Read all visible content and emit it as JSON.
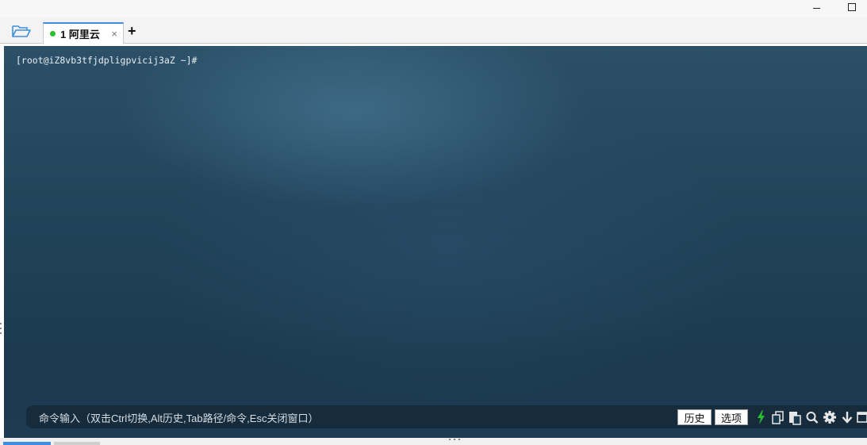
{
  "tabs": [
    {
      "label": "1 阿里云",
      "status_color": "#2bbf2b",
      "close": "×"
    }
  ],
  "tab_add": "+",
  "terminal": {
    "prompt": "[root@iZ8vb3tfjdpligpvicij3aZ ~]#"
  },
  "command_bar": {
    "hint": "命令输入（双击Ctrl切换,Alt历史,Tab路径/命令,Esc关闭窗口）",
    "history_button": "历史",
    "options_button": "选项",
    "tool_icons": [
      "lightning-icon",
      "copy-icon",
      "paste-icon",
      "search-icon",
      "gear-icon",
      "download-icon",
      "window-icon"
    ]
  },
  "colors": {
    "accent": "#3d8ee0",
    "terminal_bg": "#21435a",
    "lightning": "#2bbf2b"
  }
}
